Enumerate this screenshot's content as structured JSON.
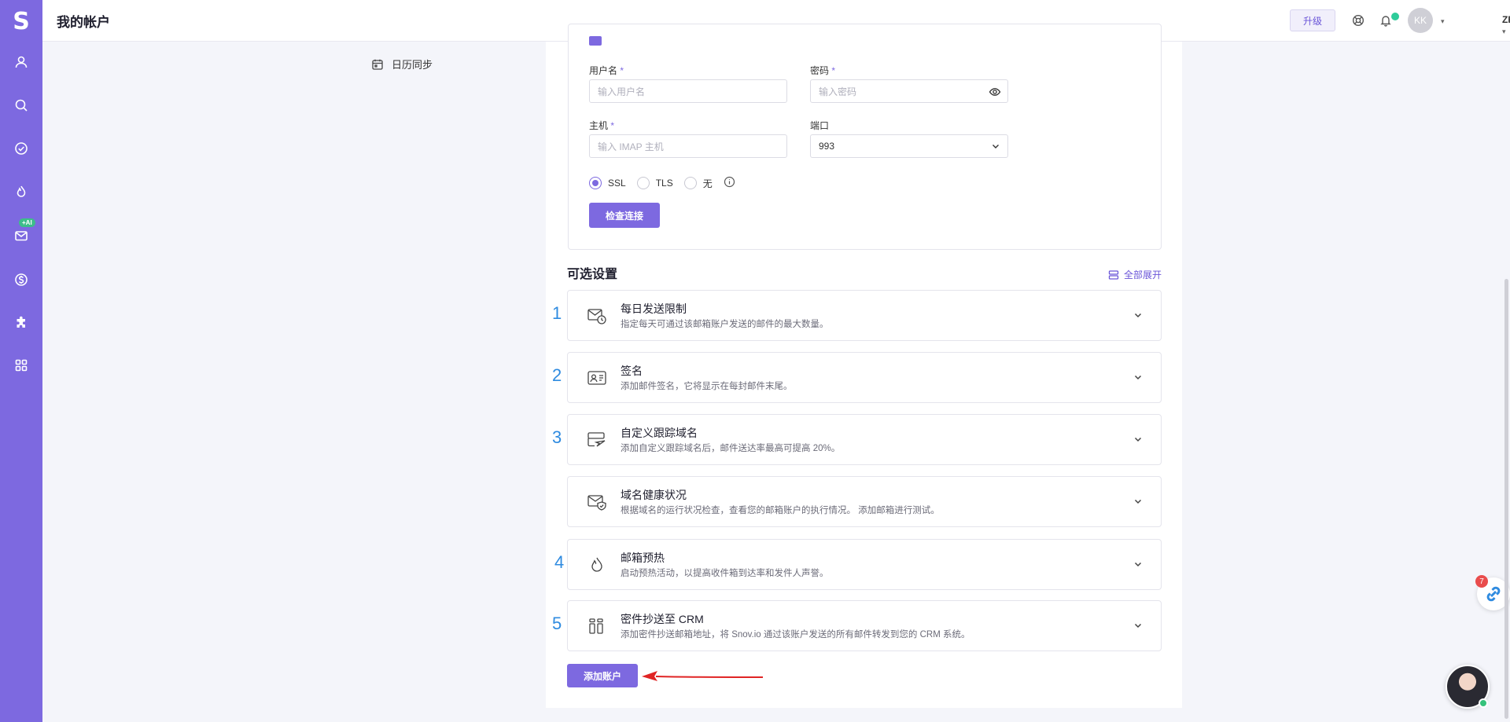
{
  "header": {
    "page_title": "我的帐户",
    "upgrade_label": "升级",
    "avatar_initials": "KK",
    "language": "ZH"
  },
  "rail": {
    "logo": "S",
    "ai_badge": "+AI",
    "items": [
      "user-icon",
      "search-icon",
      "check-circle-icon",
      "flame-icon",
      "mail-icon",
      "dollar-icon",
      "puzzle-icon",
      "apps-grid-icon"
    ]
  },
  "side_menu": {
    "calendar_sync": "日历同步"
  },
  "form": {
    "username_label": "用户名",
    "username_placeholder": "输入用户名",
    "password_label": "密码",
    "password_placeholder": "输入密码",
    "host_label": "主机",
    "host_placeholder": "输入 IMAP 主机",
    "port_label": "端口",
    "port_value": "993",
    "required_mark": "*",
    "security_options": [
      "SSL",
      "TLS",
      "无"
    ],
    "security_selected": "SSL",
    "check_connection": "检查连接"
  },
  "optional": {
    "title": "可选设置",
    "expand_all": "全部展开",
    "items": [
      {
        "num": "1",
        "title": "每日发送限制",
        "desc": "指定每天可通过该邮箱账户发送的邮件的最大数量。",
        "icon": "mail-clock-icon"
      },
      {
        "num": "2",
        "title": "签名",
        "desc": "添加邮件签名，它将显示在每封邮件末尾。",
        "icon": "id-card-icon"
      },
      {
        "num": "3",
        "title": "自定义跟踪域名",
        "desc": "添加自定义跟踪域名后，邮件送达率最高可提高 20%。",
        "icon": "tracking-send-icon"
      },
      {
        "num": "",
        "title": "域名健康状况",
        "desc": "根据域名的运行状况检查，查看您的邮箱账户的执行情况。 添加邮箱进行测试。",
        "icon": "mail-shield-icon"
      },
      {
        "num": "4",
        "title": "邮箱预热",
        "desc": "启动预热活动，以提高收件箱到达率和发件人声誉。",
        "icon": "flame-icon"
      },
      {
        "num": "5",
        "title": "密件抄送至 CRM",
        "desc": "添加密件抄送邮箱地址，将 Snov.io 通过该账户发送的所有邮件转发到您的 CRM 系统。",
        "icon": "crm-icon"
      }
    ]
  },
  "add_account": "添加账户",
  "widget_badge": "7",
  "colors": {
    "primary": "#7d69e0",
    "annotation": "#2f8be0",
    "arrow": "#e02424",
    "online": "#36c27c"
  }
}
